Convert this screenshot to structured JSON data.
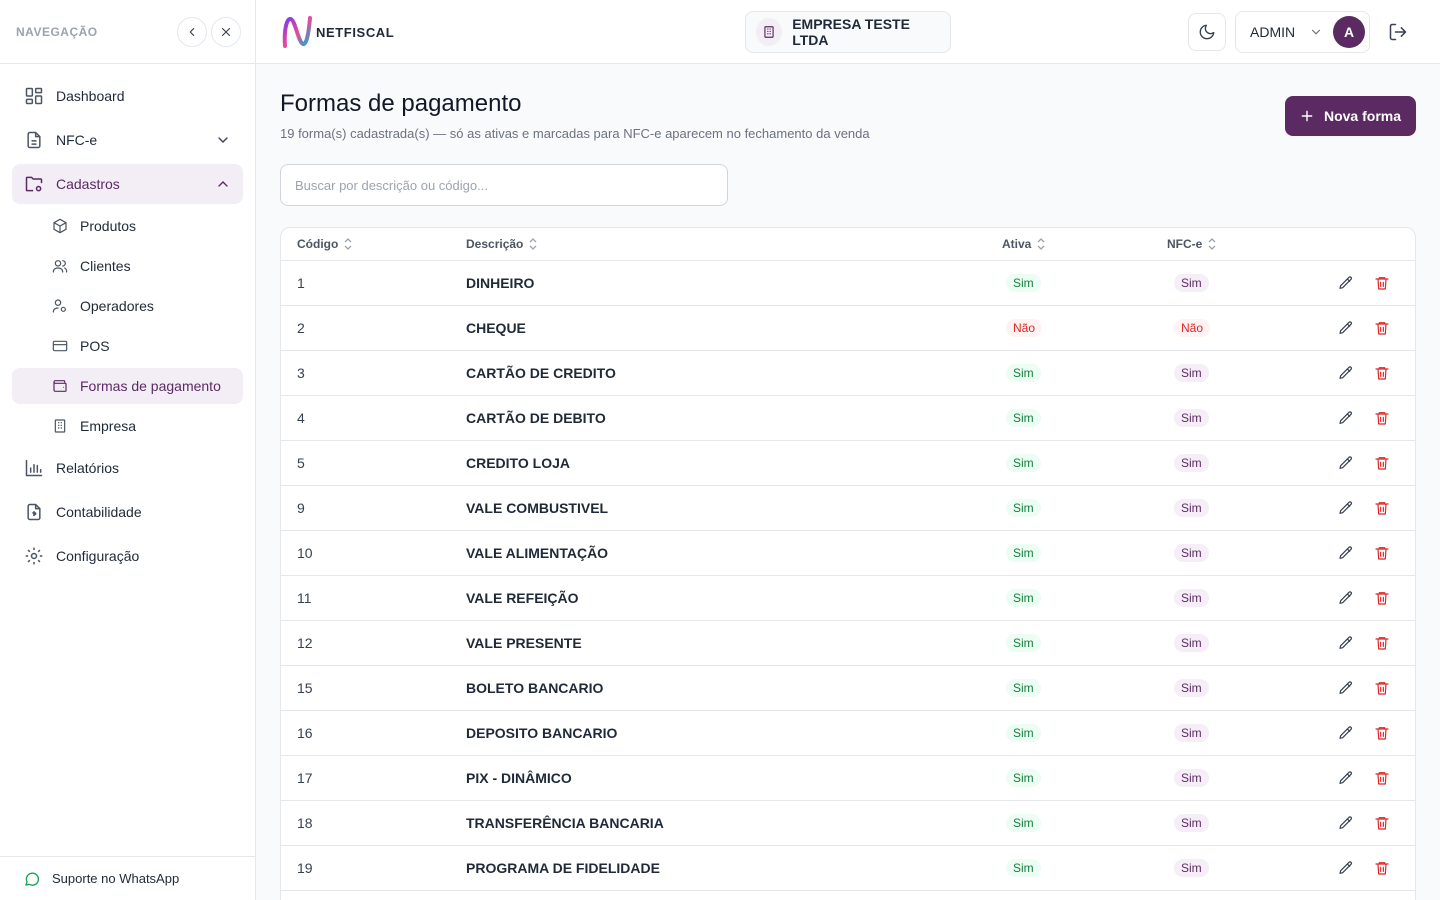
{
  "sidebar": {
    "heading": "NAVEGAÇÃO",
    "items": [
      {
        "label": "Dashboard"
      },
      {
        "label": "NFC-e"
      },
      {
        "label": "Cadastros"
      },
      {
        "label": "Relatórios"
      },
      {
        "label": "Contabilidade"
      },
      {
        "label": "Configuração"
      }
    ],
    "sub_items": [
      {
        "label": "Produtos"
      },
      {
        "label": "Clientes"
      },
      {
        "label": "Operadores"
      },
      {
        "label": "POS"
      },
      {
        "label": "Formas de pagamento"
      },
      {
        "label": "Empresa"
      }
    ],
    "footer": "Suporte no WhatsApp"
  },
  "topbar": {
    "logo_text": "NETFISCAL",
    "company": "EMPRESA TESTE LTDA",
    "user": "ADMIN",
    "avatar_initial": "A"
  },
  "page": {
    "title": "Formas de pagamento",
    "subtitle": "19 forma(s) cadastrada(s) — só as ativas e marcadas para NFC-e aparecem no fechamento da venda",
    "new_button": "Nova forma",
    "search_placeholder": "Buscar por descrição ou código..."
  },
  "table": {
    "columns": [
      "Código",
      "Descrição",
      "Ativa",
      "NFC-e"
    ],
    "rows": [
      {
        "code": "1",
        "desc": "DINHEIRO",
        "ativa": "Sim",
        "nfce": "Sim"
      },
      {
        "code": "2",
        "desc": "CHEQUE",
        "ativa": "Não",
        "nfce": "Não"
      },
      {
        "code": "3",
        "desc": "CARTÃO DE CREDITO",
        "ativa": "Sim",
        "nfce": "Sim"
      },
      {
        "code": "4",
        "desc": "CARTÃO DE DEBITO",
        "ativa": "Sim",
        "nfce": "Sim"
      },
      {
        "code": "5",
        "desc": "CREDITO LOJA",
        "ativa": "Sim",
        "nfce": "Sim"
      },
      {
        "code": "9",
        "desc": "VALE COMBUSTIVEL",
        "ativa": "Sim",
        "nfce": "Sim"
      },
      {
        "code": "10",
        "desc": "VALE ALIMENTAÇÃO",
        "ativa": "Sim",
        "nfce": "Sim"
      },
      {
        "code": "11",
        "desc": "VALE REFEIÇÃO",
        "ativa": "Sim",
        "nfce": "Sim"
      },
      {
        "code": "12",
        "desc": "VALE PRESENTE",
        "ativa": "Sim",
        "nfce": "Sim"
      },
      {
        "code": "15",
        "desc": "BOLETO BANCARIO",
        "ativa": "Sim",
        "nfce": "Sim"
      },
      {
        "code": "16",
        "desc": "DEPOSITO BANCARIO",
        "ativa": "Sim",
        "nfce": "Sim"
      },
      {
        "code": "17",
        "desc": "PIX - DINÂMICO",
        "ativa": "Sim",
        "nfce": "Sim"
      },
      {
        "code": "18",
        "desc": "TRANSFERÊNCIA BANCARIA",
        "ativa": "Sim",
        "nfce": "Sim"
      },
      {
        "code": "19",
        "desc": "PROGRAMA DE FIDELIDADE",
        "ativa": "Sim",
        "nfce": "Sim"
      }
    ]
  },
  "colors": {
    "brand": "#5b2a63",
    "success": "#15803d",
    "danger": "#dc2626"
  }
}
